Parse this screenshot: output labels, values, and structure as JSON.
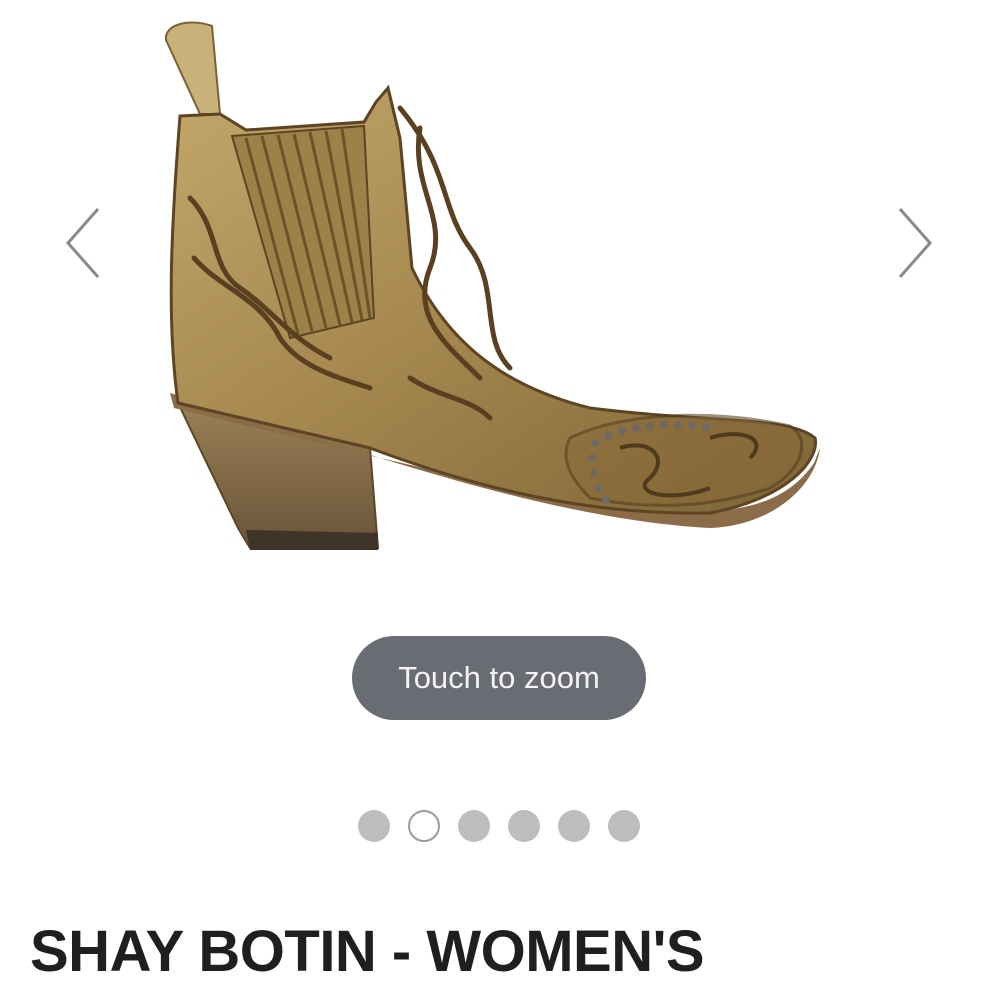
{
  "gallery": {
    "prev_icon": "chevron-left-icon",
    "next_icon": "chevron-right-icon",
    "image_alt": "SHAY BOTIN - WOMEN'S",
    "zoom_label": "Touch to zoom",
    "slide_count": 6,
    "active_index": 1
  },
  "product": {
    "title": "SHAY BOTIN - WOMEN'S"
  },
  "colors": {
    "pill_bg": "#696c73",
    "dot_inactive": "#bdbdbd",
    "title_text": "#1f1f1f"
  }
}
